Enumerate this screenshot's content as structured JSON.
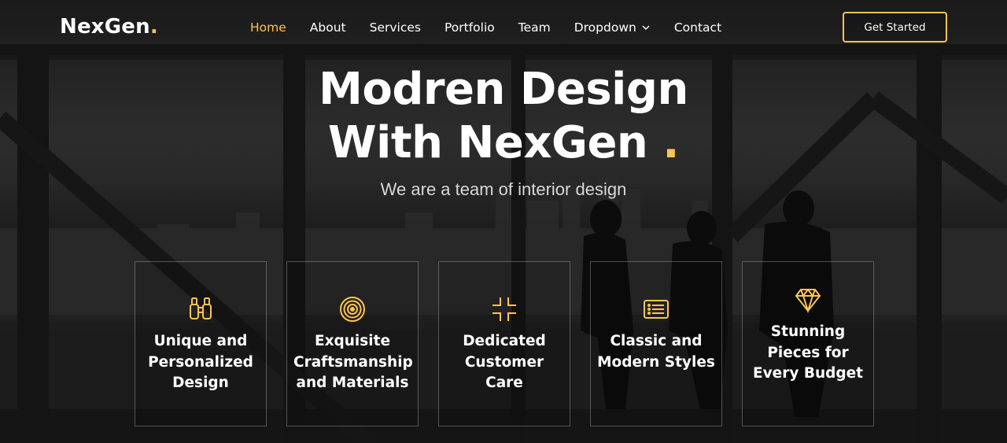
{
  "brand": {
    "name": "NexGen",
    "dot": ".",
    "accent_color": "#ffc451"
  },
  "nav": {
    "items": [
      {
        "label": "Home",
        "active": true
      },
      {
        "label": "About",
        "active": false
      },
      {
        "label": "Services",
        "active": false
      },
      {
        "label": "Portfolio",
        "active": false
      },
      {
        "label": "Team",
        "active": false
      },
      {
        "label": "Dropdown",
        "active": false,
        "icon": "chevron-down-icon"
      },
      {
        "label": "Contact",
        "active": false
      }
    ],
    "cta_label": "Get Started"
  },
  "hero": {
    "title_line1": "Modren Design",
    "title_line2": "With NexGen",
    "title_dot": ".",
    "subtitle": "We are a team of interior design"
  },
  "features": [
    {
      "icon": "binoculars-icon",
      "label": "Unique and Personalized Design"
    },
    {
      "icon": "bullseye-icon",
      "label": "Exquisite Craftsmanship and Materials"
    },
    {
      "icon": "fullscreen-exit-icon",
      "label": "Dedicated Customer Care"
    },
    {
      "icon": "card-list-icon",
      "label": "Classic and Modern Styles"
    },
    {
      "icon": "gem-icon",
      "label": "Stunning Pieces for Every Budget"
    }
  ]
}
